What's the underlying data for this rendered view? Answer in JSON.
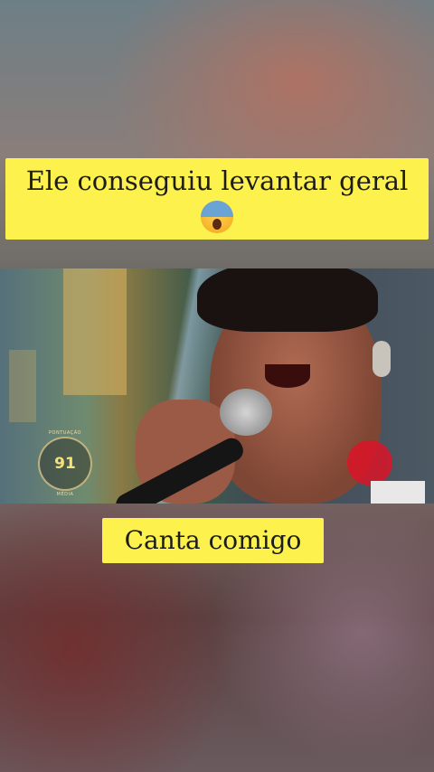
{
  "captions": {
    "top": "Ele conseguiu levantar geral",
    "top_emoji": "face-screaming-in-fear",
    "bottom": "Canta comigo"
  },
  "video": {
    "score_label_top": "PONTUAÇÃO",
    "score_value": "91",
    "score_label_bottom": "MÉDIA"
  },
  "colors": {
    "caption_bg": "#fdf14d",
    "caption_text": "#1c1c1c"
  }
}
